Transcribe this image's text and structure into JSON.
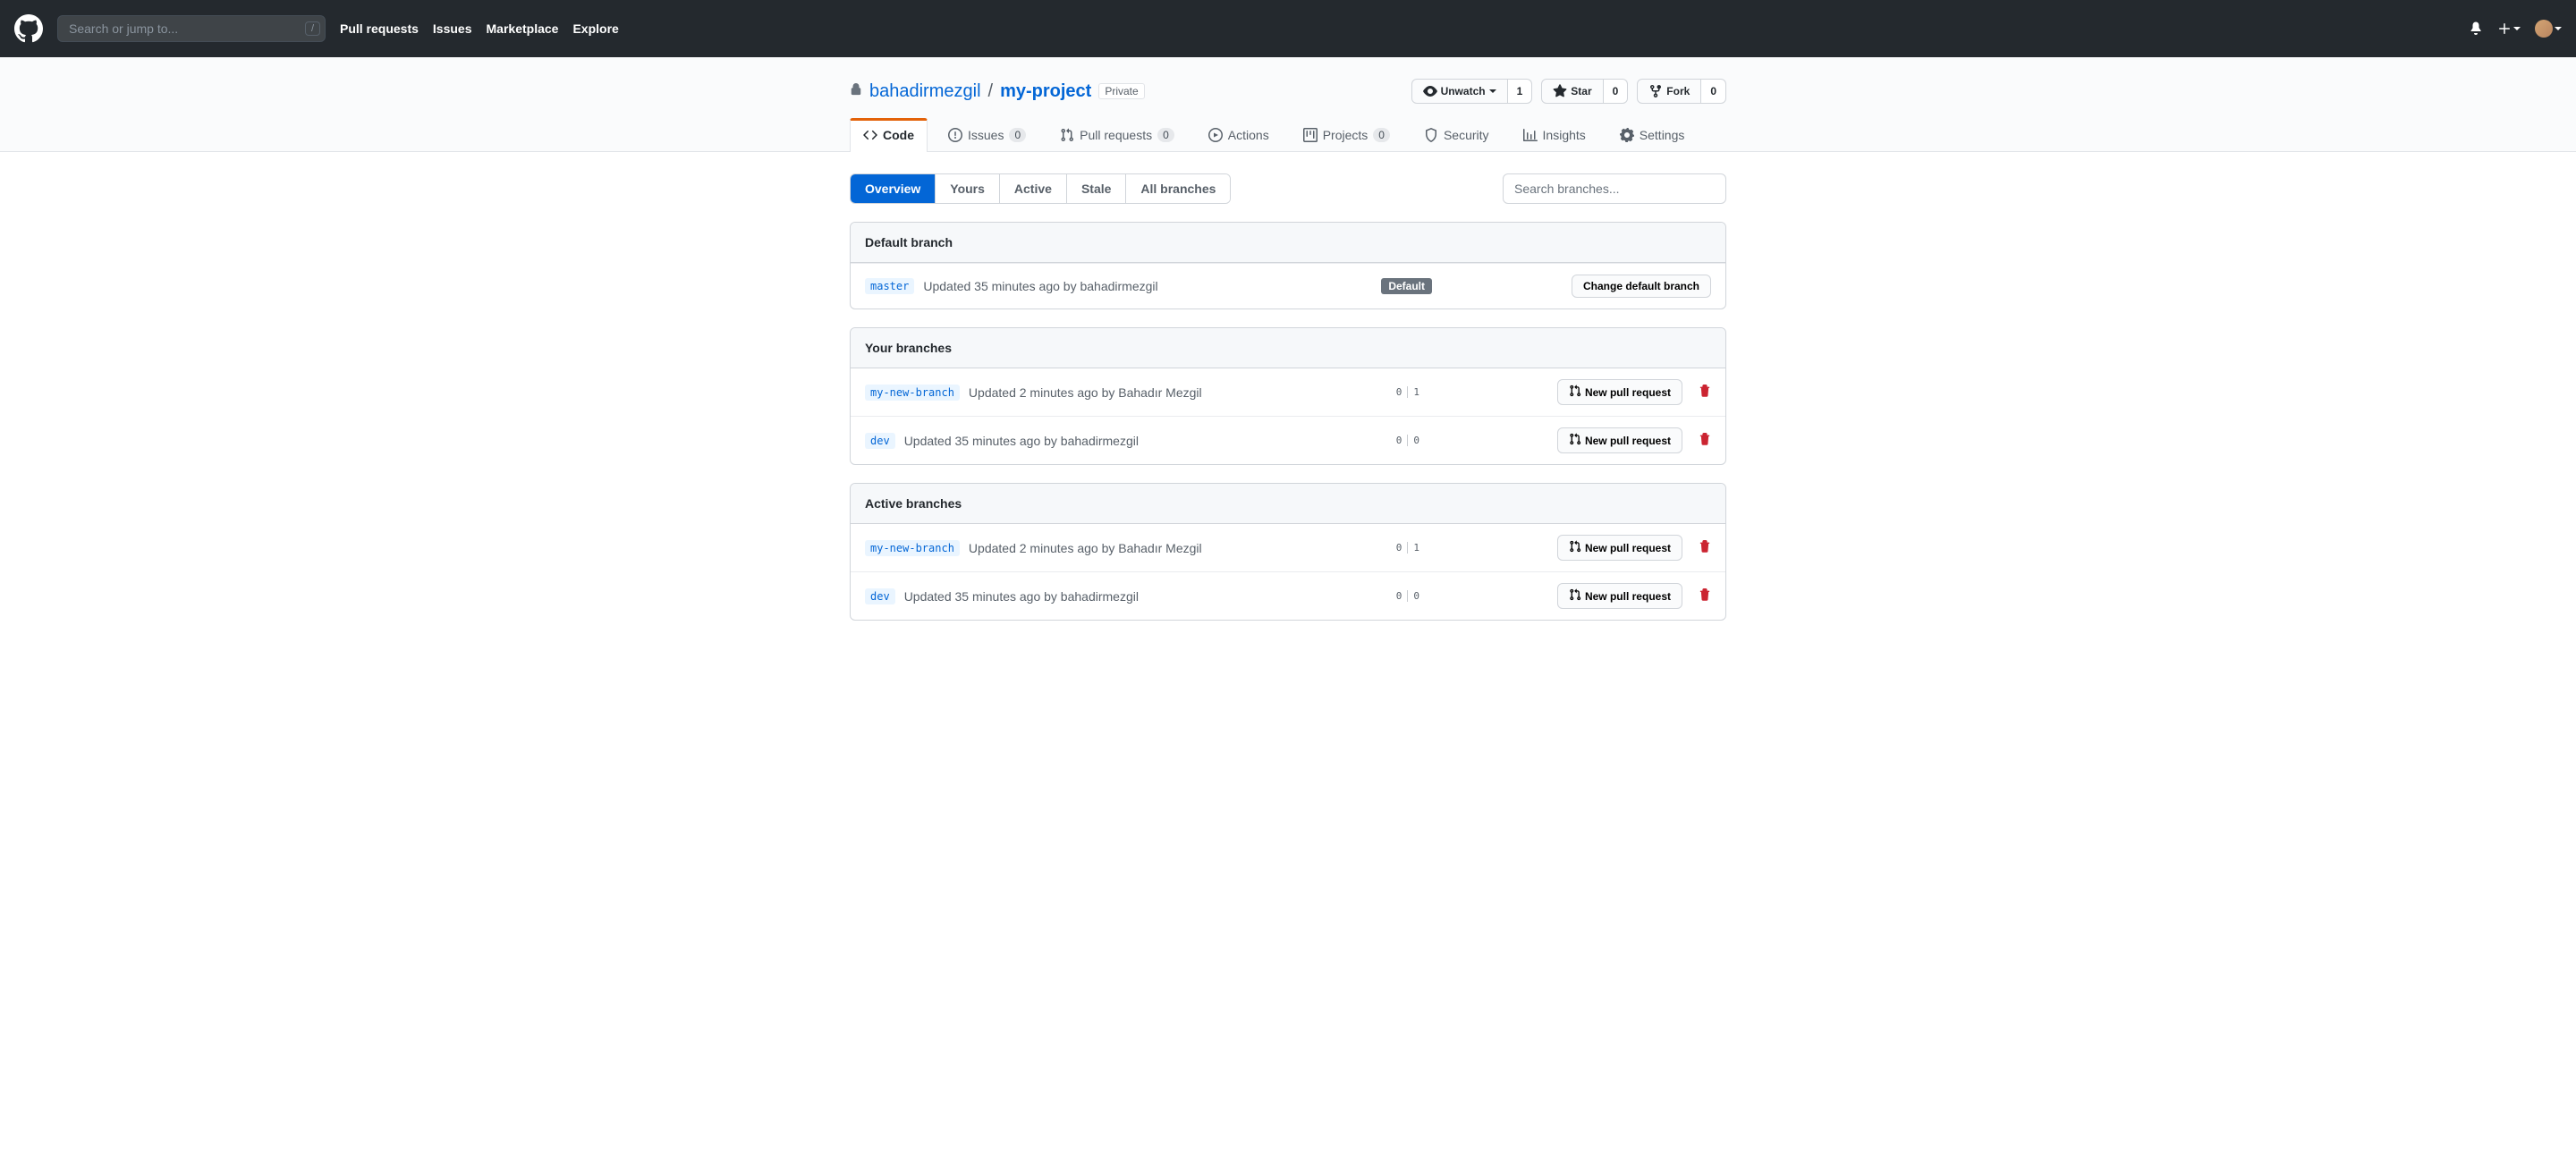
{
  "header": {
    "search_placeholder": "Search or jump to...",
    "nav": [
      "Pull requests",
      "Issues",
      "Marketplace",
      "Explore"
    ]
  },
  "repo": {
    "owner": "bahadirmezgil",
    "name": "my-project",
    "visibility": "Private",
    "watch_label": "Unwatch",
    "watch_count": "1",
    "star_label": "Star",
    "star_count": "0",
    "fork_label": "Fork",
    "fork_count": "0"
  },
  "tabs": {
    "code": "Code",
    "issues": "Issues",
    "issues_count": "0",
    "pulls": "Pull requests",
    "pulls_count": "0",
    "actions": "Actions",
    "projects": "Projects",
    "projects_count": "0",
    "security": "Security",
    "insights": "Insights",
    "settings": "Settings"
  },
  "filters": {
    "overview": "Overview",
    "yours": "Yours",
    "active": "Active",
    "stale": "Stale",
    "all": "All branches",
    "search_placeholder": "Search branches..."
  },
  "sections": {
    "default_title": "Default branch",
    "default_badge": "Default",
    "change_button": "Change default branch",
    "your_title": "Your branches",
    "active_title": "Active branches",
    "npr_label": "New pull request"
  },
  "branches": {
    "default": {
      "name": "master",
      "meta": "Updated 35 minutes ago by bahadirmezgil"
    },
    "yours": [
      {
        "name": "my-new-branch",
        "meta": "Updated 2 minutes ago by Bahadır Mezgil",
        "behind": "0",
        "ahead": "1"
      },
      {
        "name": "dev",
        "meta": "Updated 35 minutes ago by bahadirmezgil",
        "behind": "0",
        "ahead": "0"
      }
    ],
    "active": [
      {
        "name": "my-new-branch",
        "meta": "Updated 2 minutes ago by Bahadır Mezgil",
        "behind": "0",
        "ahead": "1"
      },
      {
        "name": "dev",
        "meta": "Updated 35 minutes ago by bahadirmezgil",
        "behind": "0",
        "ahead": "0"
      }
    ]
  }
}
